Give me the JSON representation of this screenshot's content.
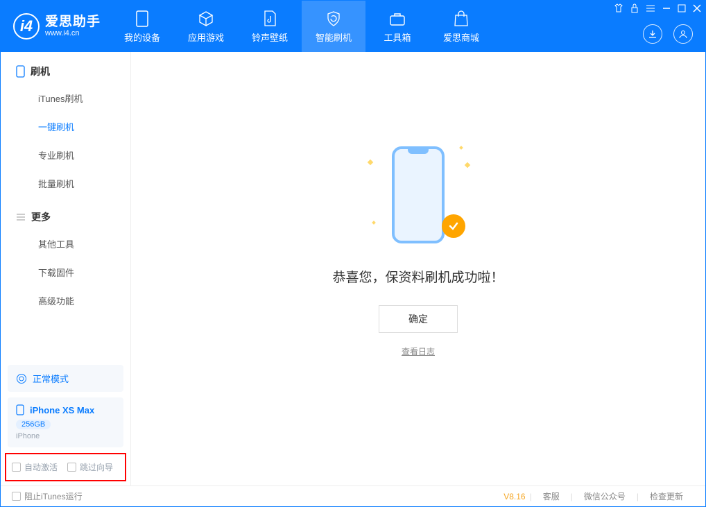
{
  "app": {
    "title": "爱思助手",
    "subtitle": "www.i4.cn"
  },
  "tabs": {
    "device": "我的设备",
    "apps": "应用游戏",
    "wallpaper": "铃声壁纸",
    "flash": "智能刷机",
    "toolbox": "工具箱",
    "store": "爱思商城"
  },
  "sidebar": {
    "flash_section": "刷机",
    "flash_items": {
      "itunes": "iTunes刷机",
      "oneclick": "一键刷机",
      "pro": "专业刷机",
      "batch": "批量刷机"
    },
    "more_section": "更多",
    "more_items": {
      "other": "其他工具",
      "download": "下载固件",
      "advanced": "高级功能"
    }
  },
  "device": {
    "mode": "正常模式",
    "name": "iPhone XS Max",
    "capacity": "256GB",
    "type": "iPhone"
  },
  "checks": {
    "auto_activate": "自动激活",
    "skip_guide": "跳过向导"
  },
  "main": {
    "success_msg": "恭喜您，保资料刷机成功啦！",
    "ok": "确定",
    "view_log": "查看日志"
  },
  "footer": {
    "block_itunes": "阻止iTunes运行",
    "version": "V8.16",
    "support": "客服",
    "wechat": "微信公众号",
    "update": "检查更新"
  }
}
